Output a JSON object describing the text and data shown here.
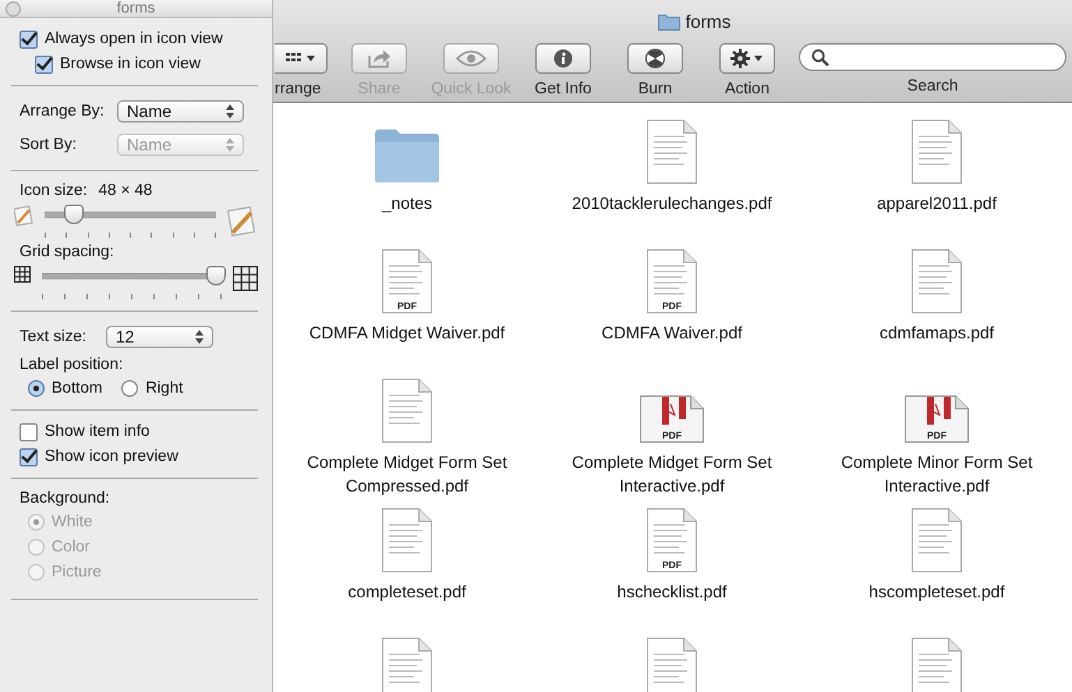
{
  "window": {
    "title": "forms"
  },
  "toolbar": [
    {
      "label": "rrange",
      "kind": "arrange",
      "disabled": false
    },
    {
      "label": "Share",
      "kind": "share",
      "disabled": true
    },
    {
      "label": "Quick Look",
      "kind": "quicklook",
      "disabled": true
    },
    {
      "label": "Get Info",
      "kind": "info",
      "disabled": false
    },
    {
      "label": "Burn",
      "kind": "burn",
      "disabled": false
    },
    {
      "label": "Action",
      "kind": "action",
      "disabled": false
    }
  ],
  "search": {
    "label": "Search"
  },
  "files": [
    {
      "name": "_notes",
      "kind": "folder"
    },
    {
      "name": "2010tacklerulechanges.pdf",
      "kind": "doc"
    },
    {
      "name": "apparel2011.pdf",
      "kind": "doc"
    },
    {
      "name": "CDMFA Midget Waiver.pdf",
      "kind": "doc",
      "badge": "PDF"
    },
    {
      "name": "CDMFA Waiver.pdf",
      "kind": "doc",
      "badge": "PDF"
    },
    {
      "name": "cdmfamaps.pdf",
      "kind": "doc"
    },
    {
      "name": "Complete Midget Form Set Compressed.pdf",
      "kind": "doc"
    },
    {
      "name": "Complete Midget Form Set Interactive.pdf",
      "kind": "acrobat",
      "badge": "PDF"
    },
    {
      "name": "Complete Minor Form Set Interactive.pdf",
      "kind": "acrobat",
      "badge": "PDF"
    },
    {
      "name": "completeset.pdf",
      "kind": "doc"
    },
    {
      "name": "hschecklist.pdf",
      "kind": "doc",
      "badge": "PDF"
    },
    {
      "name": "hscompleteset.pdf",
      "kind": "doc"
    },
    {
      "kind": "doc"
    },
    {
      "kind": "doc"
    },
    {
      "kind": "doc"
    }
  ],
  "view_options": {
    "title": "forms",
    "always_open": {
      "label": "Always open in icon view",
      "checked": true
    },
    "browse": {
      "label": "Browse in icon view",
      "checked": true
    },
    "arrange_by": {
      "label": "Arrange By:",
      "value": "Name",
      "disabled": false
    },
    "sort_by": {
      "label": "Sort By:",
      "value": "Name",
      "disabled": true
    },
    "icon_size": {
      "label": "Icon size:",
      "reading": "48 × 48",
      "level": 0.17
    },
    "grid_spacing": {
      "label": "Grid spacing:",
      "level": 0.97
    },
    "text_size": {
      "label": "Text size:",
      "value": "12"
    },
    "label_position": {
      "label": "Label position:",
      "options": [
        {
          "label": "Bottom",
          "selected": true
        },
        {
          "label": "Right",
          "selected": false
        }
      ]
    },
    "show_item_info": {
      "label": "Show item info",
      "checked": false
    },
    "show_icon_preview": {
      "label": "Show icon preview",
      "checked": true
    },
    "background": {
      "label": "Background:",
      "disabled": true,
      "options": [
        {
          "label": "White",
          "selected": true
        },
        {
          "label": "Color",
          "selected": false
        },
        {
          "label": "Picture",
          "selected": false
        }
      ]
    }
  }
}
